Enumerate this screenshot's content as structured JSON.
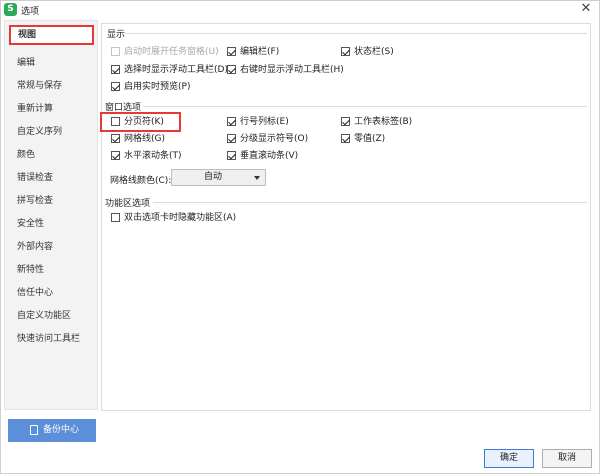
{
  "window": {
    "title": "选项",
    "close_glyph": "✕",
    "app_icon_glyph": "S"
  },
  "sidebar": {
    "items": [
      {
        "label": "视图",
        "active": true
      },
      {
        "label": "编辑"
      },
      {
        "label": "常规与保存"
      },
      {
        "label": "重新计算"
      },
      {
        "label": "自定义序列"
      },
      {
        "label": "颜色"
      },
      {
        "label": "错误检查"
      },
      {
        "label": "拼写检查"
      },
      {
        "label": "安全性"
      },
      {
        "label": "外部内容"
      },
      {
        "label": "新特性"
      },
      {
        "label": "信任中心"
      },
      {
        "label": "自定义功能区"
      },
      {
        "label": "快速访问工具栏"
      }
    ],
    "backup_label": "备份中心"
  },
  "display": {
    "title": "显示",
    "options": [
      {
        "label": "启动时展开任务窗格(U)",
        "checked": false,
        "disabled": true
      },
      {
        "label": "编辑栏(F)",
        "checked": true
      },
      {
        "label": "状态栏(S)",
        "checked": true
      },
      {
        "label": "选择时显示浮动工具栏(D)",
        "checked": true
      },
      {
        "label": "右键时显示浮动工具栏(H)",
        "checked": true
      },
      {
        "label": "启用实时预览(P)",
        "checked": true
      }
    ]
  },
  "window_options": {
    "title": "窗口选项",
    "options": [
      {
        "label": "分页符(K)",
        "checked": false
      },
      {
        "label": "行号列标(E)",
        "checked": true
      },
      {
        "label": "工作表标签(B)",
        "checked": true
      },
      {
        "label": "网格线(G)",
        "checked": true
      },
      {
        "label": "分级显示符号(O)",
        "checked": true
      },
      {
        "label": "零值(Z)",
        "checked": true
      },
      {
        "label": "水平滚动条(T)",
        "checked": true
      },
      {
        "label": "垂直滚动条(V)",
        "checked": true
      }
    ],
    "gridline_color_label": "网格线颜色(C):",
    "gridline_color_value": "自动"
  },
  "ribbon": {
    "title": "功能区选项",
    "options": [
      {
        "label": "双击选项卡时隐藏功能区(A)",
        "checked": false
      }
    ]
  },
  "buttons": {
    "ok": "确定",
    "cancel": "取消"
  }
}
